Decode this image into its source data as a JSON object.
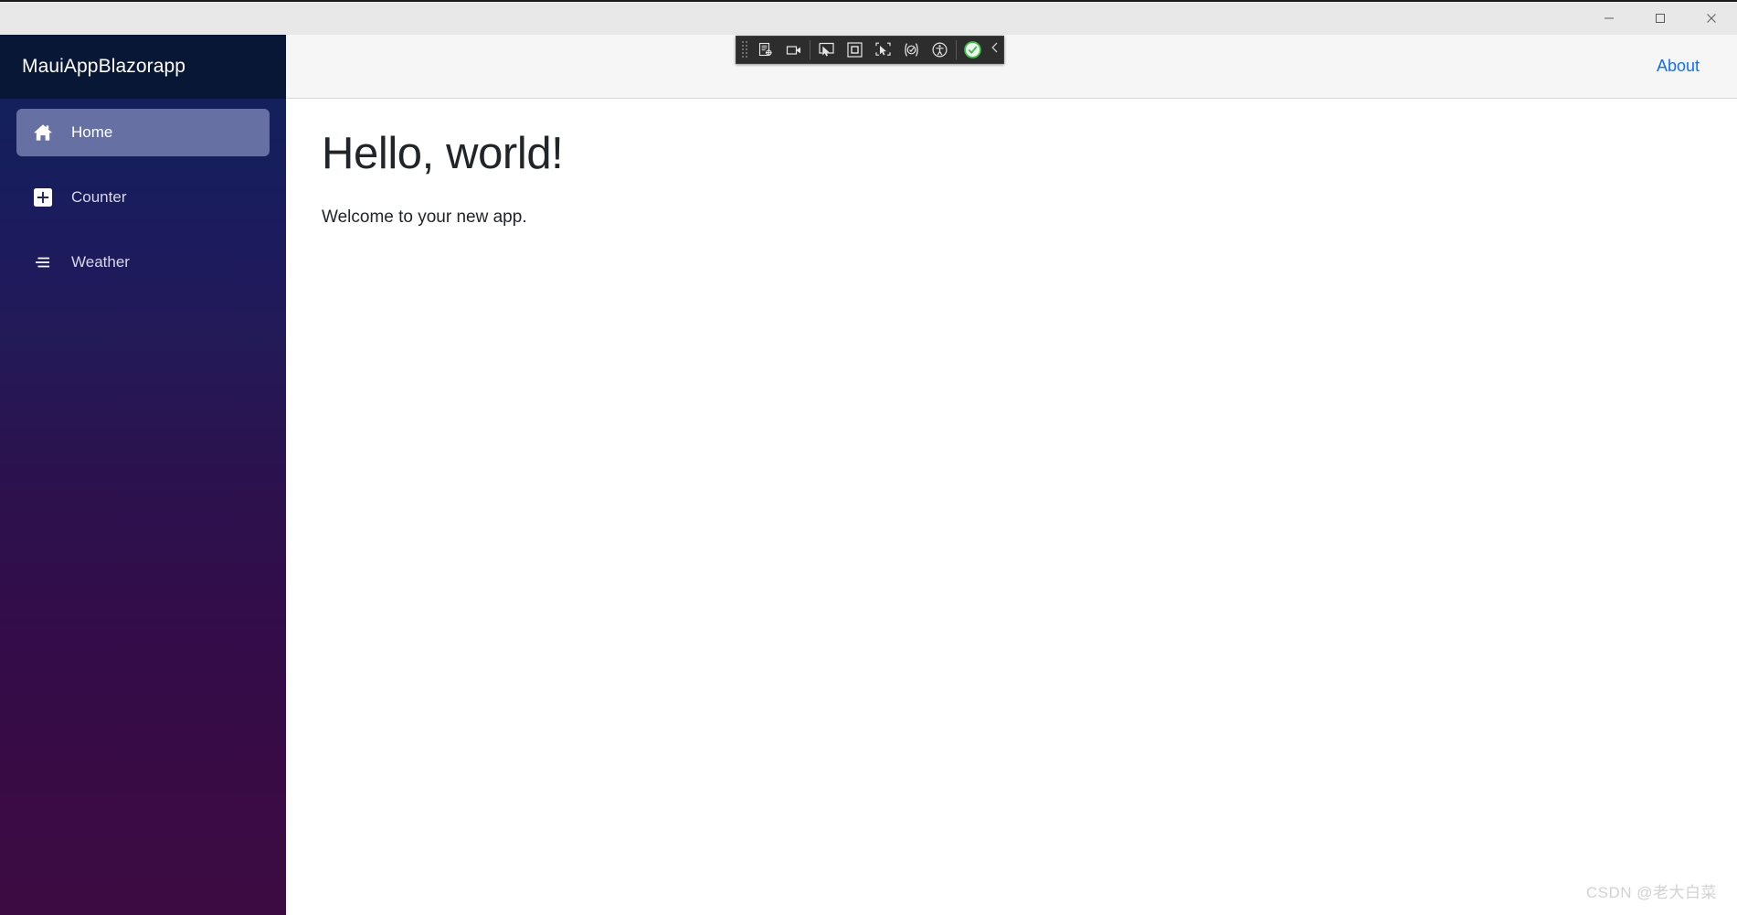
{
  "window": {
    "controls": [
      {
        "name": "minimize-button",
        "icon": "minimize-icon",
        "label": "Minimize"
      },
      {
        "name": "maximize-button",
        "icon": "maximize-icon",
        "label": "Maximize"
      },
      {
        "name": "close-button",
        "icon": "close-icon",
        "label": "Close"
      }
    ]
  },
  "sidebar": {
    "brand": "MauiAppBlazorapp",
    "brand_bg": "#081736",
    "gradient_from": "#112156",
    "gradient_to": "#3c0b42",
    "active_bg": "#6670a3",
    "items": [
      {
        "label": "Home",
        "icon": "home-icon",
        "active": true
      },
      {
        "label": "Counter",
        "icon": "plus-square-icon",
        "active": false
      },
      {
        "label": "Weather",
        "icon": "list-lines-icon",
        "active": false
      }
    ]
  },
  "topbar": {
    "about_label": "About",
    "link_color": "#0d6efd"
  },
  "content": {
    "heading": "Hello, world!",
    "subtext": "Welcome to your new app."
  },
  "vs_toolbar": {
    "background": "#2d2d2d",
    "grip_label": "Drag handle",
    "buttons": [
      {
        "name": "live-visual-tree-button",
        "icon": "live-visual-tree-icon",
        "tooltip": "Go To Live Visual Tree"
      },
      {
        "name": "record-button",
        "icon": "video-camera-icon",
        "tooltip": "Record"
      },
      {
        "name": "select-element-button",
        "icon": "select-element-icon",
        "tooltip": "Select Element"
      },
      {
        "name": "display-layout-button",
        "icon": "display-layout-icon",
        "tooltip": "Display Layout Adorners"
      },
      {
        "name": "track-focused-element-button",
        "icon": "track-focus-icon",
        "tooltip": "Track Focused Element"
      },
      {
        "name": "hot-reload-button",
        "icon": "hot-reload-icon",
        "tooltip": "Hot Reload"
      },
      {
        "name": "accessibility-button",
        "icon": "accessibility-icon",
        "tooltip": "Accessibility Checker"
      },
      {
        "name": "status-ok-button",
        "icon": "check-circle-icon",
        "tooltip": "No issues found"
      }
    ],
    "collapse": {
      "name": "collapse-toolbar-button",
      "icon": "chevron-left-icon",
      "tooltip": "Collapse"
    },
    "status_color": "#3ec34a"
  },
  "watermark": {
    "text": "CSDN @老大白菜"
  }
}
